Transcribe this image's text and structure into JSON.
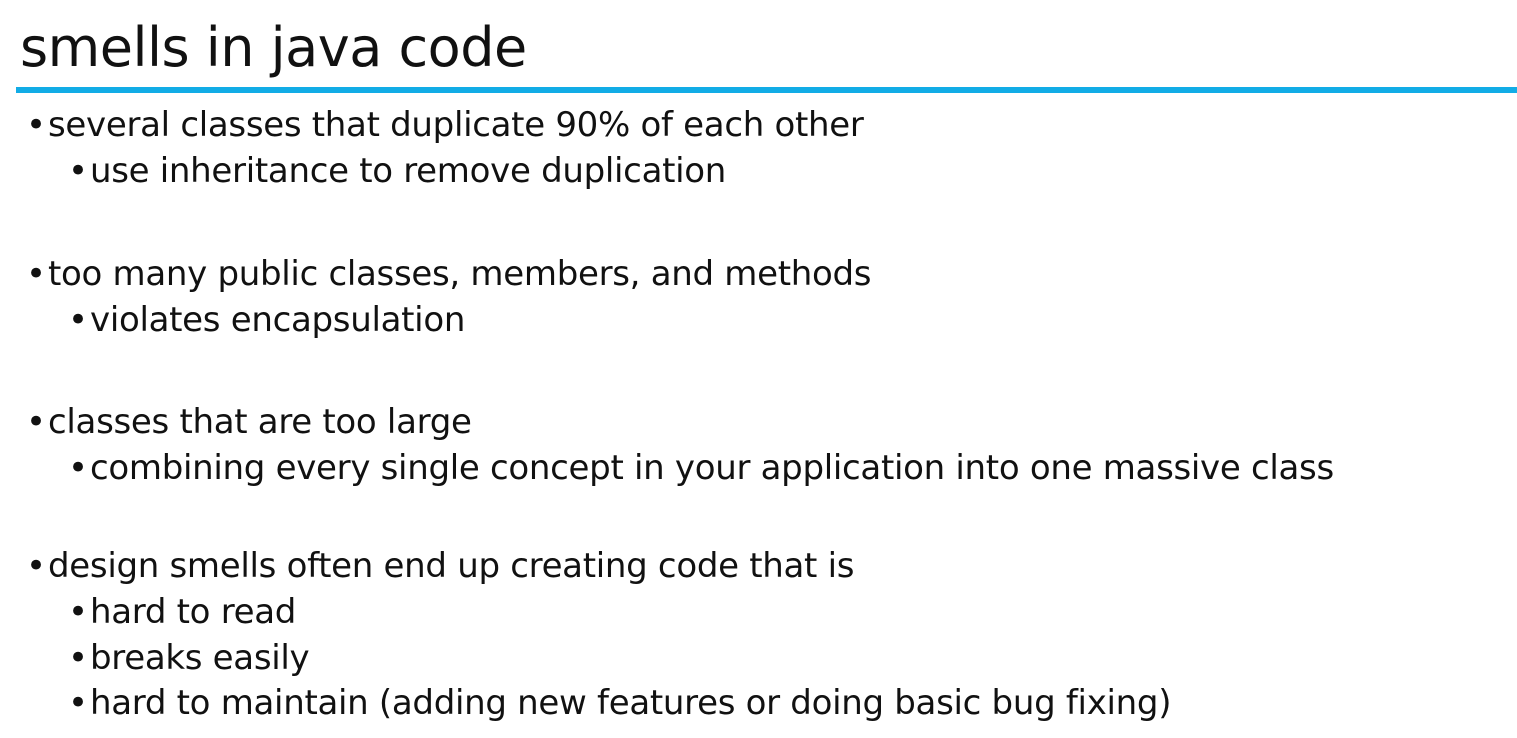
{
  "title": "smells in java code",
  "accent_color": "#12ace6",
  "bullet_glyph": "•",
  "groups": [
    {
      "text": "several classes that duplicate 90% of each other",
      "subs": [
        "use inheritance to remove duplication"
      ]
    },
    {
      "text": "too many public classes, members, and methods",
      "subs": [
        "violates encapsulation"
      ]
    },
    {
      "text": "classes that are too large",
      "subs": [
        "combining every single concept in your application into one massive class"
      ]
    },
    {
      "text": "design smells often end up creating code that is",
      "subs": [
        "hard to read",
        "breaks easily",
        "hard to maintain (adding new features or doing basic bug fixing)"
      ]
    }
  ]
}
